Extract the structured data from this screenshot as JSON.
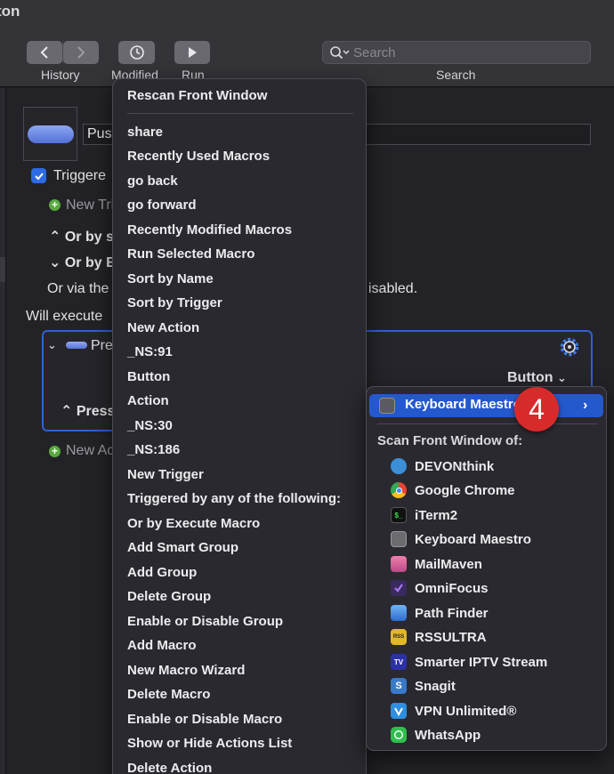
{
  "window": {
    "title": "ton"
  },
  "toolbar": {
    "history_label": "History",
    "modified_label": "Modified",
    "run_label": "Run",
    "search_label": "Search",
    "search_placeholder": "Search"
  },
  "editor": {
    "macro_name_prefix": "Pus",
    "triggered_prefix": "Triggere",
    "new_trigger_prefix": "New Tri",
    "or_by_s_prefix": "Or by s",
    "or_by_e_prefix": "Or by E",
    "or_via_prefix": "Or via the",
    "disabled_suffix": "isabled.",
    "will_execute_prefix": "Will execute",
    "action_prefix": "Pre",
    "button_select": "Button",
    "press_prefix": "Press",
    "new_action_prefix": "New Ac"
  },
  "menu": {
    "items": [
      "Rescan Front Window",
      "share",
      "Recently Used Macros",
      "go back",
      "go forward",
      "Recently Modified Macros",
      "Run Selected Macro",
      "Sort by Name",
      "Sort by Trigger",
      "New Action",
      "_NS:91",
      "Button",
      "Action",
      "_NS:30",
      "_NS:186",
      "New Trigger",
      "Triggered by any of the following:",
      "Or by Execute Macro",
      "Add Smart Group",
      "Add Group",
      "Delete Group",
      "Enable or Disable Group",
      "Add Macro",
      "New Macro Wizard",
      "Delete Macro",
      "Enable or Disable Macro",
      "Show or Hide Actions List",
      "Delete Action"
    ]
  },
  "submenu": {
    "highlighted": "Keyboard Maestro",
    "header": "Scan Front Window of:",
    "apps": [
      {
        "label": "DEVONthink",
        "icon": "devonthink-icon",
        "color": "#3c8fd6"
      },
      {
        "label": "Google Chrome",
        "icon": "chrome-icon",
        "color": "#e94235"
      },
      {
        "label": "iTerm2",
        "icon": "iterm-icon",
        "color": "#111111"
      },
      {
        "label": "Keyboard Maestro",
        "icon": "keyboard-maestro-icon",
        "color": "#6b6b70"
      },
      {
        "label": "MailMaven",
        "icon": "mailmaven-icon",
        "color": "#d7598a"
      },
      {
        "label": "OmniFocus",
        "icon": "omnifocus-icon",
        "color": "#7b4fc9"
      },
      {
        "label": "Path Finder",
        "icon": "path-finder-icon",
        "color": "#3f83d9"
      },
      {
        "label": "RSSULTRA",
        "icon": "rssultra-icon",
        "color": "#e3b72c"
      },
      {
        "label": "Smarter IPTV Stream",
        "icon": "iptv-icon",
        "color": "#3b3fc4"
      },
      {
        "label": "Snagit",
        "icon": "snagit-icon",
        "color": "#3a78c8"
      },
      {
        "label": "VPN Unlimited®",
        "icon": "vpn-icon",
        "color": "#2d8fe0"
      },
      {
        "label": "WhatsApp",
        "icon": "whatsapp-icon",
        "color": "#2fbf4f"
      }
    ]
  },
  "badge": {
    "number": "4",
    "color": "#d72b2b"
  }
}
